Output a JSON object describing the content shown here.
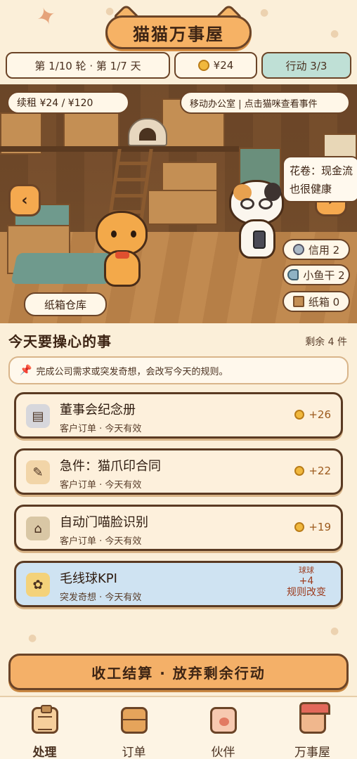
{
  "title": "猫猫万事屋",
  "stats": {
    "round": "第 1/10 轮 · 第 1/7 天",
    "coins": "¥24",
    "actions": "行动 3/3"
  },
  "scene": {
    "rent": "续租 ¥24 / ¥120",
    "move_hint": "移动办公室 | 点击猫咪查看事件",
    "location": "纸箱仓库",
    "speech": "花卷：现金流也很健康",
    "resources": [
      {
        "icon": "credit-icon",
        "label": "信用 2"
      },
      {
        "icon": "fish-icon",
        "label": "小鱼干 2"
      },
      {
        "icon": "box-icon",
        "label": "纸箱 0"
      }
    ]
  },
  "tasks_section": {
    "title": "今天要操心的事",
    "remaining": "剩余 4 件",
    "tip": "完成公司需求或突发奇想，会改写今天的规则。"
  },
  "tasks": [
    {
      "title": "董事会纪念册",
      "subtitle": "客户订单 · 今天有效",
      "reward": "+26",
      "icon": "cash-register-icon"
    },
    {
      "title": "急件：猫爪印合同",
      "subtitle": "客户订单 · 今天有效",
      "reward": "+22",
      "icon": "contract-icon"
    },
    {
      "title": "自动门喵脸识别",
      "subtitle": "客户订单 · 今天有效",
      "reward": "+19",
      "icon": "shop-icon"
    },
    {
      "title": "毛线球KPI",
      "subtitle": "突发奇想 · 今天有效",
      "rule_top": "球球",
      "rule_mid": "+4",
      "rule_bottom": "规则改变",
      "icon": "yarn-bell-icon"
    }
  ],
  "end_button": "收工结算 · 放弃剩余行动",
  "bottom_nav": [
    {
      "label": "处理",
      "icon": "clipboard-icon"
    },
    {
      "label": "订单",
      "icon": "box-icon"
    },
    {
      "label": "伙伴",
      "icon": "paw-icon"
    },
    {
      "label": "万事屋",
      "icon": "house-icon"
    }
  ],
  "colors": {
    "background": "#fbefd9",
    "accent": "#f6b265",
    "outline": "#6b4427",
    "actions_bg": "#bfe0d6",
    "special_task_bg": "#cfe3f2"
  }
}
